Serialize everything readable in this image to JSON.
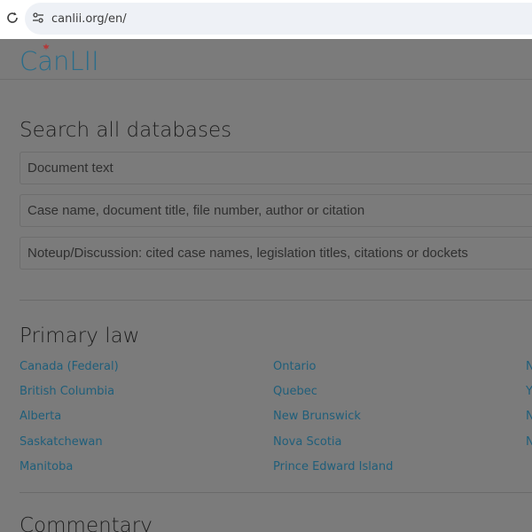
{
  "browser": {
    "url": "canlii.org/en/"
  },
  "header": {
    "logo": "CanLII"
  },
  "search": {
    "title": "Search all databases",
    "document_text_placeholder": "Document text",
    "case_name_placeholder": "Case name, document title, file number, author or citation",
    "noteup_placeholder": "Noteup/Discussion: cited case names, legislation titles, citations or dockets"
  },
  "primary_law": {
    "title": "Primary law",
    "col1": [
      "Canada (Federal)",
      "British Columbia",
      "Alberta",
      "Saskatchewan",
      "Manitoba"
    ],
    "col2": [
      "Ontario",
      "Quebec",
      "New Brunswick",
      "Nova Scotia",
      "Prince Edward Island"
    ],
    "col3": [
      "N",
      "Y",
      "N",
      "N"
    ]
  },
  "commentary": {
    "title": "Commentary"
  },
  "colors": {
    "overlay": "#7b7b7b",
    "link": "#1f5e7a",
    "logo": "#2b6d8a"
  }
}
